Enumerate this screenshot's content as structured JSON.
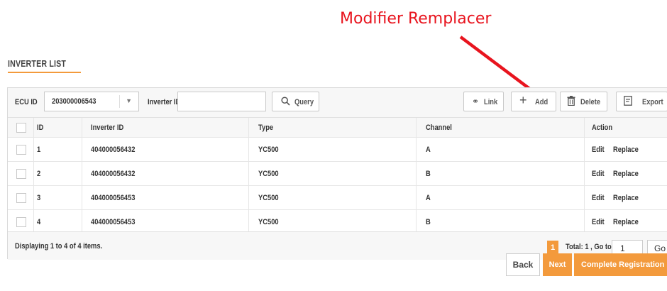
{
  "annotation": {
    "text": "Modifier Remplacer",
    "color": "#e8141e"
  },
  "section": {
    "title": "INVERTER LIST"
  },
  "toolbar": {
    "ecu_label": "ECU ID",
    "ecu_value": "203000006543",
    "inverter_label": "Inverter ID",
    "inverter_value": "",
    "query_label": "Query",
    "link_label": "Link",
    "add_label": "Add",
    "delete_label": "Delete",
    "export_label": "Export"
  },
  "table": {
    "columns": [
      "ID",
      "Inverter ID",
      "Type",
      "Channel",
      "Action"
    ],
    "rows": [
      {
        "id": "1",
        "inverter_id": "404000056432",
        "type": "YC500",
        "channel": "A",
        "edit": "Edit",
        "replace": "Replace"
      },
      {
        "id": "2",
        "inverter_id": "404000056432",
        "type": "YC500",
        "channel": "B",
        "edit": "Edit",
        "replace": "Replace"
      },
      {
        "id": "3",
        "inverter_id": "404000056453",
        "type": "YC500",
        "channel": "A",
        "edit": "Edit",
        "replace": "Replace"
      },
      {
        "id": "4",
        "inverter_id": "404000056453",
        "type": "YC500",
        "channel": "B",
        "edit": "Edit",
        "replace": "Replace"
      }
    ]
  },
  "footer": {
    "summary": "Displaying 1 to 4 of 4 items.",
    "page": "1",
    "total": "Total: 1 , Go to",
    "goto_value": "1",
    "go_label": "Go"
  },
  "actions": {
    "back": "Back",
    "next": "Next",
    "complete": "Complete Registration"
  },
  "colors": {
    "accent": "#f39a3c",
    "annotation": "#e8141e"
  }
}
